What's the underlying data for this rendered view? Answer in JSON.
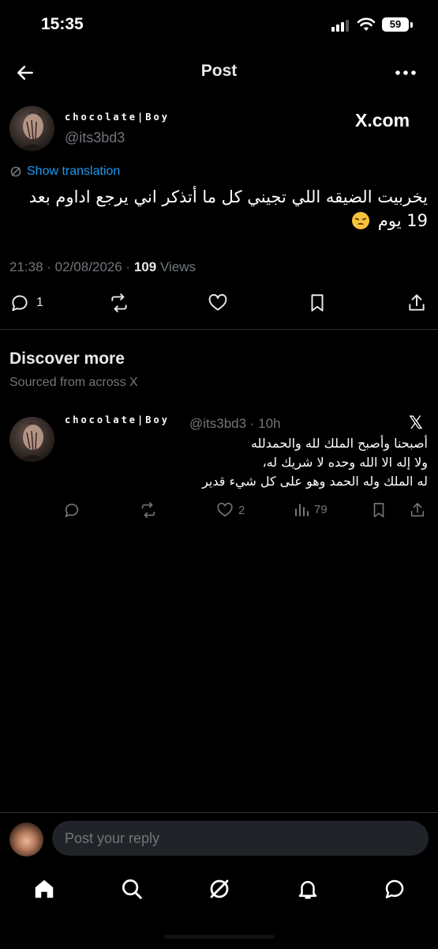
{
  "status_bar": {
    "time": "15:35",
    "battery": "59"
  },
  "header": {
    "title": "Post"
  },
  "post": {
    "author_name": "chocolate|Boy",
    "author_handle": "@its3bd3",
    "badge": "X.com",
    "translation_label": "Show translation",
    "text": "يخربيت الضيقه اللي تجيني كل ما أتذكر اني يرجع اداوم بعد 19 يوم",
    "time": "21:38 · 02/08/2026 · ",
    "views_count": "109",
    "views_label": " Views",
    "reply_count": "1"
  },
  "discover": {
    "title": "Discover more",
    "subtitle": "Sourced from across X"
  },
  "related_post": {
    "author_name": "chocolate|Boy",
    "handle_time": "@its3bd3 · 10h",
    "lines": [
      "أصبحنا وأصبح الملك لله والحمدلله",
      "ولا إله الا الله وحده لا شريك له،",
      "له الملك وله الحمد وهو على كل شيء قدير"
    ],
    "likes": "2",
    "views": "79"
  },
  "reply": {
    "placeholder": "Post your reply"
  },
  "colors": {
    "accent": "#1d9bf0",
    "muted": "#71767b",
    "background": "#000000"
  }
}
